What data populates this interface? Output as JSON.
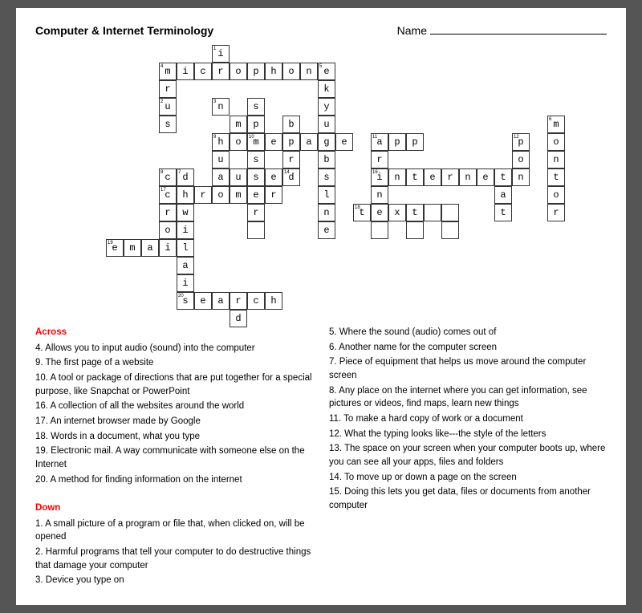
{
  "header": {
    "title": "Computer & Internet Terminology",
    "name_label": "Name"
  },
  "clues": {
    "across_heading": "Across",
    "across": [
      "4. Allows you to input audio (sound) into the computer",
      "9. The first page of a website",
      "10. A tool or package of directions that are put together for a special purpose, like Snapchat or PowerPoint",
      "16. A collection of all the websites around the world",
      "17. An internet browser made by Google",
      "18. Words in a document, what you type",
      "19. Electronic mail. A way communicate with someone else on the Internet",
      "20. A method for finding information on the internet"
    ],
    "down_heading": "Down",
    "down": [
      "1. A small picture of a program or file that, when clicked on, will be opened",
      "2. Harmful programs that tell your computer to do destructive things that damage your computer",
      "3. Device you type on"
    ],
    "right_col": [
      "5. Where the sound (audio) comes out of",
      "6. Another name for the computer screen",
      "7. Piece of equipment that helps us move around the computer screen",
      "8. Any place on the internet where you can get information, see pictures or videos, find maps, learn new things",
      "11. To make a hard copy of work or a document",
      "12. What the typing looks like---the style of the letters",
      "13. The space on your screen when your computer boots up, where you can see all your apps, files and folders",
      "14. To move up or down a page on the screen",
      "15. Doing this lets you get data, files or documents from another computer"
    ]
  }
}
